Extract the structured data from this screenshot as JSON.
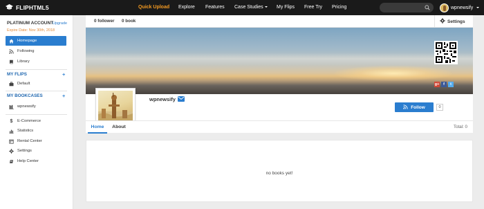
{
  "nav": {
    "logo": "FLIPHTML5",
    "items": [
      {
        "label": "Quick Upload",
        "active": true
      },
      {
        "label": "Explore"
      },
      {
        "label": "Features"
      },
      {
        "label": "Case Studies"
      },
      {
        "label": "My Flips"
      },
      {
        "label": "Free Try"
      },
      {
        "label": "Pricing"
      }
    ],
    "username": "wpnewsify"
  },
  "sidebar": {
    "account_title": "PLATINUM ACCOUNT",
    "upgrade_label": "Upgrade",
    "expire_text": "Expire Date: Nov 30th, 2018",
    "main_items": [
      {
        "label": "Homepage",
        "icon": "home-icon",
        "active": true
      },
      {
        "label": "Following",
        "icon": "rss-icon"
      },
      {
        "label": "Library",
        "icon": "book-icon"
      }
    ],
    "flips_heading": "MY FLIPS",
    "flips_items": [
      {
        "label": "Default",
        "icon": "briefcase-icon"
      }
    ],
    "bookcases_heading": "MY BOOKCASES",
    "bookcases_items": [
      {
        "label": "wpnewsify",
        "icon": "bookshelf-icon"
      }
    ],
    "tool_items": [
      {
        "label": "E-Commerce",
        "icon": "dollar-icon"
      },
      {
        "label": "Statistics",
        "icon": "bar-chart-icon"
      },
      {
        "label": "Rental Center",
        "icon": "rental-icon"
      },
      {
        "label": "Settings",
        "icon": "gear-icon"
      },
      {
        "label": "Help Center",
        "icon": "help-icon"
      }
    ]
  },
  "stats": {
    "followers": "0 follower",
    "books": "0 book",
    "settings_label": "Settings"
  },
  "profile": {
    "name": "wpnewsify",
    "follow_label": "Follow",
    "follow_count": "0"
  },
  "tabs": [
    {
      "label": "Home",
      "active": true
    },
    {
      "label": "About"
    }
  ],
  "total": "Total: 0",
  "empty_message": "no books yet!",
  "social": [
    "g+",
    "f",
    "t"
  ],
  "colors": {
    "accent": "#2a7dcf",
    "quick_upload": "#f39a22",
    "nav_bg": "#1a1a1a"
  }
}
